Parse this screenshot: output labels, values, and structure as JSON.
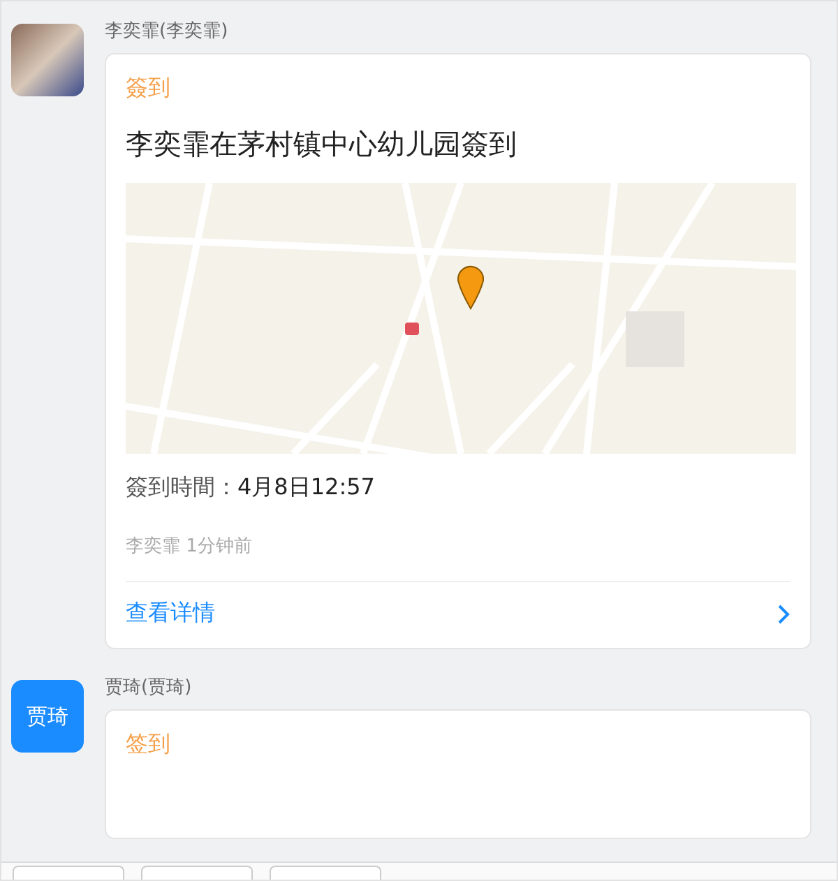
{
  "messages": [
    {
      "sender": "李奕霏(李奕霏)",
      "avatar": {
        "kind": "photo"
      },
      "card": {
        "type_label": "簽到",
        "title": "李奕霏在茅村镇中心幼儿园簽到",
        "media": {
          "kind": "map"
        },
        "time_label": "簽到時間：",
        "time_value": "4月8日12:57",
        "meta": "李奕霏 1分钟前",
        "link": "查看详情"
      }
    },
    {
      "sender": "贾琦(贾琦)",
      "avatar": {
        "kind": "text",
        "text": "贾琦"
      },
      "card": {
        "type_label": "签到"
      }
    }
  ],
  "toolbar": {
    "buttons": [
      {
        "kind": "blank"
      },
      {
        "kind": "blank"
      },
      {
        "kind": "blank"
      }
    ]
  }
}
